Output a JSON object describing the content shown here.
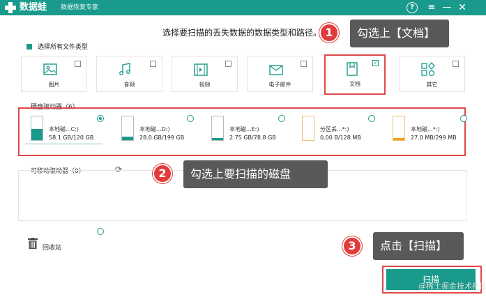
{
  "app": {
    "name": "数据蛙",
    "subtitle": "数据恢复专家"
  },
  "titlebar": {
    "help_icon": "question-circle-icon",
    "menu_icon": "hamburger-menu-icon",
    "minimize_icon": "minimize-icon",
    "close_icon": "close-icon",
    "help_glyph": "?",
    "menu_glyph": "≡",
    "minimize_glyph": "—",
    "close_glyph": "✕"
  },
  "instruction": "选择要扫描的丢失数据的数据类型和路径。",
  "select_all": "选择所有文件类型",
  "file_types": [
    {
      "label": "图片",
      "checked": false,
      "icon": "image-icon"
    },
    {
      "label": "音频",
      "checked": false,
      "icon": "music-icon"
    },
    {
      "label": "视频",
      "checked": false,
      "icon": "video-icon"
    },
    {
      "label": "电子邮件",
      "checked": false,
      "icon": "email-icon"
    },
    {
      "label": "文档",
      "checked": true,
      "icon": "document-icon"
    },
    {
      "label": "其它",
      "checked": false,
      "icon": "other-shapes-icon"
    }
  ],
  "hard_drives": {
    "label": "硬盘驱动器（6）",
    "items": [
      {
        "name": "本地磁...C:)",
        "size": "58.1 GB/120 GB",
        "selected": true,
        "fill": 0.48,
        "color": "#1a9a8c"
      },
      {
        "name": "本地磁...D:)",
        "size": "28.0 GB/199 GB",
        "selected": false,
        "fill": 0.14,
        "color": "#1a9a8c"
      },
      {
        "name": "本地磁...E:)",
        "size": "2.75 GB/78.8 GB",
        "selected": false,
        "fill": 0.03,
        "color": "#1a9a8c"
      },
      {
        "name": "分区丢...*:)",
        "size": "0.00  B/128 MB",
        "selected": false,
        "fill": 0.0,
        "color": "#f0a020"
      },
      {
        "name": "本地磁...*:)",
        "size": "27.0 MB/299 MB",
        "selected": false,
        "fill": 0.09,
        "color": "#f0a020"
      }
    ]
  },
  "removable": {
    "label": "可移动驱动器（0）",
    "refresh_icon": "refresh-icon",
    "refresh_glyph": "⟳"
  },
  "recycle": {
    "label": "回收站",
    "icon": "trash-icon"
  },
  "callouts": [
    {
      "num": "1",
      "text": "勾选上【文档】"
    },
    {
      "num": "2",
      "text": "勾选上要扫描的磁盘"
    },
    {
      "num": "3",
      "text": "点击【扫描】"
    }
  ],
  "scan_button": "扫描",
  "watermark": "@稀土掘金技术社区",
  "colors": {
    "accent": "#1a9a8c",
    "highlight": "#e04848",
    "callout_bg": "#595959",
    "badge": "#e23b3b"
  }
}
